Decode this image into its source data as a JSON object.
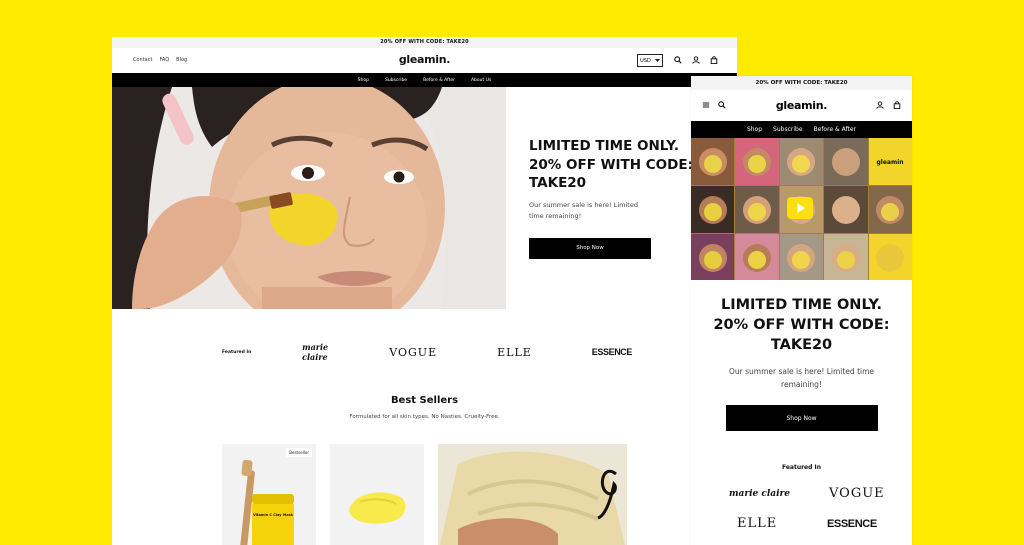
{
  "desktop": {
    "announcement": "20% OFF WITH CODE: TAKE20",
    "header": {
      "links": [
        "Contact",
        "FAQ",
        "Blog"
      ],
      "logo": "gleamin.",
      "currency": "USD"
    },
    "nav": [
      "Shop",
      "Subscribe",
      "Before & After",
      "About Us"
    ],
    "hero": {
      "headline_1": "LIMITED TIME ONLY.",
      "headline_2": "20% OFF WITH CODE:",
      "headline_3": "TAKE20",
      "body": "Our summer sale is here! Limited time remaining!",
      "cta": "Shop Now"
    },
    "press": {
      "label": "Featured In",
      "logos": [
        "marie claire",
        "VOGUE",
        "ELLE",
        "ESSENCE"
      ]
    },
    "best_sellers": {
      "title": "Best Sellers",
      "subtitle": "Formulated for all skin types. No Nasties. Cruelty-Free.",
      "badge": "Bestseller",
      "product_label": "Vitamin C Clay Mask"
    }
  },
  "mobile": {
    "announcement": "20% OFF WITH CODE: TAKE20",
    "logo": "gleamin.",
    "nav": [
      "Shop",
      "Subscribe",
      "Before & After"
    ],
    "video_tile_text": "gleamin",
    "hero": {
      "headline": "LIMITED TIME ONLY. 20% OFF WITH CODE: TAKE20",
      "body": "Our summer sale is here! Limited time remaining!",
      "cta": "Shop Now"
    },
    "press": {
      "label": "Featured In",
      "logos": [
        "marie claire",
        "VOGUE",
        "ELLE",
        "ESSENCE"
      ]
    }
  },
  "colors": {
    "background": "#FFEB00",
    "brand_yellow": "#F2D42B",
    "black": "#000000"
  },
  "icons": [
    "chevron-down-icon",
    "search-icon",
    "account-icon",
    "cart-icon",
    "menu-icon",
    "play-icon"
  ]
}
